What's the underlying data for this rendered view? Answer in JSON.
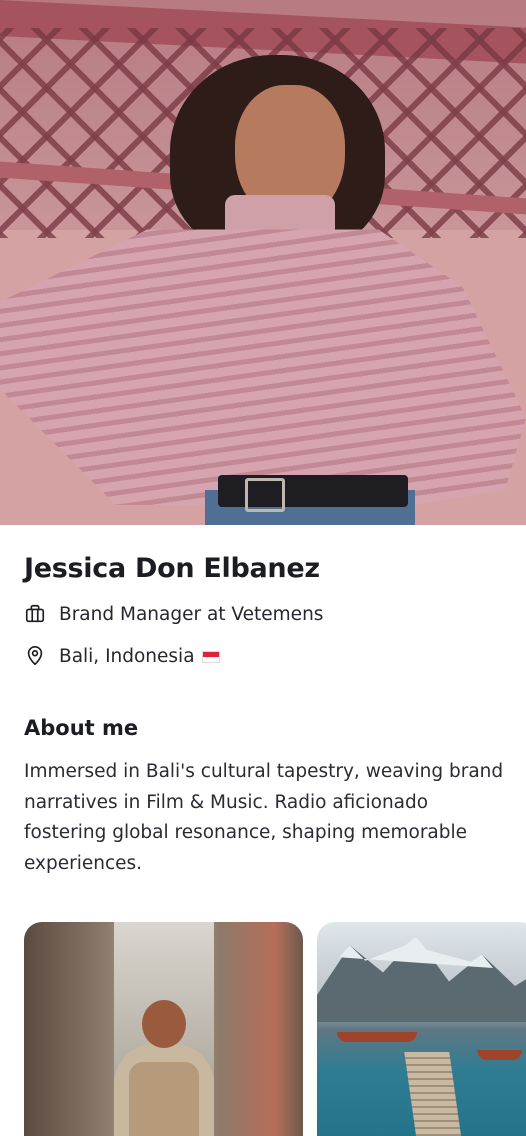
{
  "profile": {
    "name": "Jessica Don Elbanez",
    "job": "Brand Manager at Vetemens",
    "location": "Bali, Indonesia"
  },
  "about": {
    "title": "About me",
    "bio": "Immersed in Bali's cultural tapestry, weaving brand narratives in Film & Music. Radio aficionado fostering global resonance, shaping memorable experiences."
  },
  "icons": {
    "job": "briefcase-icon",
    "location": "location-pin-icon",
    "flag": "indonesia-flag-icon"
  },
  "colors": {
    "text": "#1c1d22",
    "background": "#ffffff"
  }
}
